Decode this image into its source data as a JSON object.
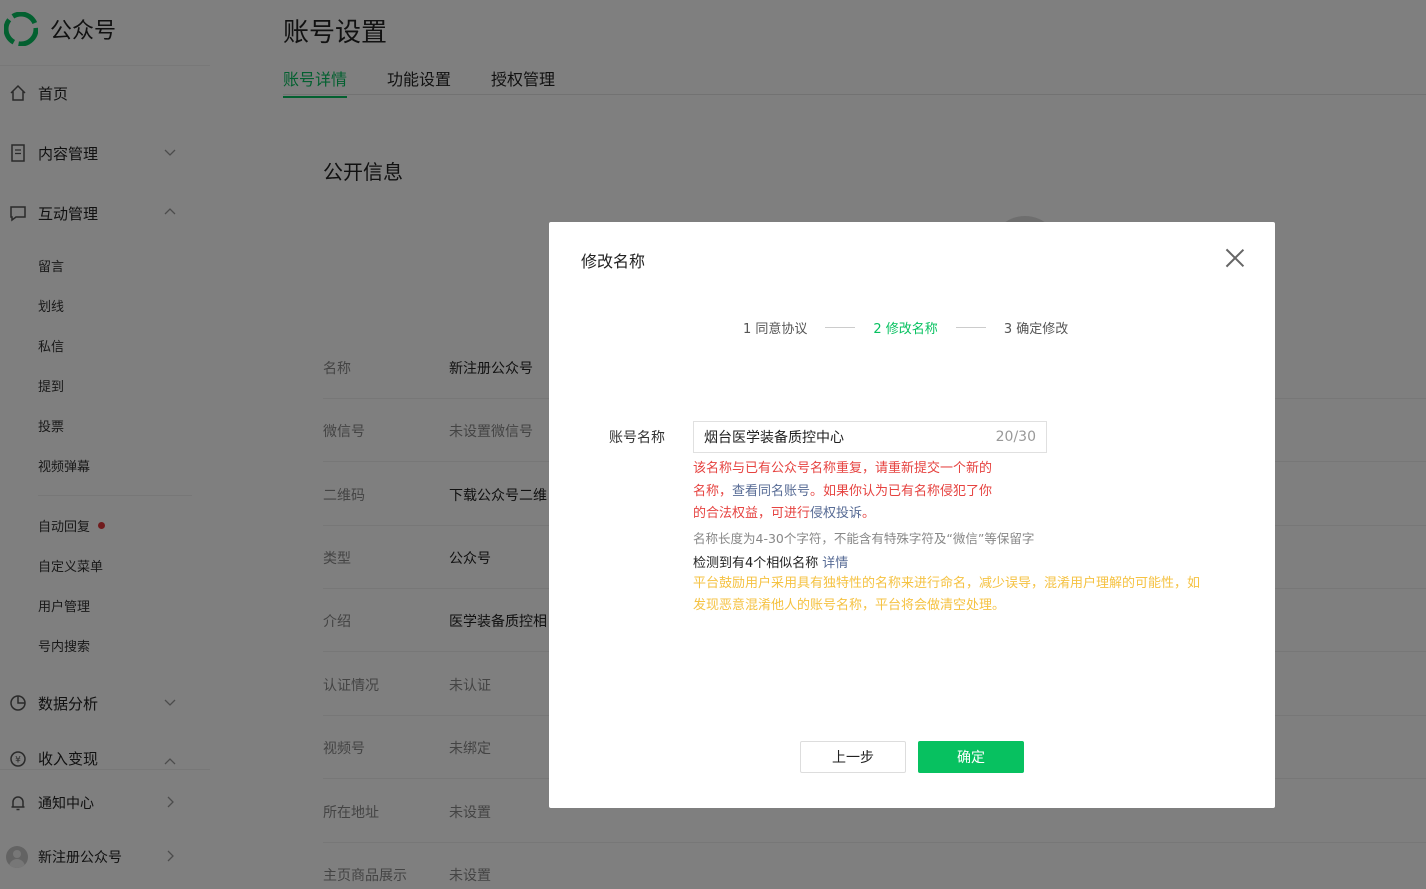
{
  "app": {
    "name": "公众号",
    "brand_color": "#07c160"
  },
  "sidebar": {
    "home": "首页",
    "content": "内容管理",
    "interaction": "互动管理",
    "interaction_sub": [
      "留言",
      "划线",
      "私信",
      "提到",
      "投票",
      "视频弹幕"
    ],
    "interaction_sub2": [
      "自动回复",
      "自定义菜单",
      "用户管理",
      "号内搜索"
    ],
    "analytics": "数据分析",
    "monetize": "收入变现",
    "notifications": "通知中心",
    "account": "新注册公众号"
  },
  "page": {
    "title": "账号设置",
    "tabs": [
      "账号详情",
      "功能设置",
      "授权管理"
    ],
    "section_title": "公开信息",
    "rows": [
      {
        "label": "名称",
        "value": "新注册公众号"
      },
      {
        "label": "微信号",
        "value": "未设置微信号"
      },
      {
        "label": "二维码",
        "value": "下载公众号二维"
      },
      {
        "label": "类型",
        "value": "公众号"
      },
      {
        "label": "介绍",
        "value": "医学装备质控相"
      },
      {
        "label": "认证情况",
        "value": "未认证"
      },
      {
        "label": "视频号",
        "value": "未绑定"
      },
      {
        "label": "所在地址",
        "value": "未设置"
      },
      {
        "label": "主页商品展示",
        "value": "未设置"
      }
    ]
  },
  "dialog": {
    "title": "修改名称",
    "steps": [
      "1 同意协议",
      "2 修改名称",
      "3 确定修改"
    ],
    "active_step": 2,
    "field_label": "账号名称",
    "name_value": "烟台医学装备质控中心",
    "name_count": "20/30",
    "error_part1": "该名称与已有公众号名称重复，请重新提交一个新的名称，",
    "error_link1": "查看同名账号",
    "error_part2": "。如果你认为已有名称侵犯了你的合法权益，可进行",
    "error_link2": "侵权投诉",
    "error_part3": "。",
    "hint": "名称长度为4-30个字符，不能含有特殊字符及“微信”等保留字",
    "similar_text": "检测到有4个相似名称",
    "similar_link": "详情",
    "warning": "平台鼓励用户采用具有独特性的名称来进行命名，减少误导，混淆用户理解的可能性，如发现恶意混淆他人的账号名称，平台将会做清空处理。",
    "btn_prev": "上一步",
    "btn_ok": "确定"
  }
}
